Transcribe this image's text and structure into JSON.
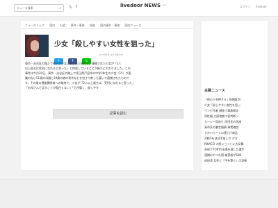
{
  "header": {
    "search_placeholder": "ニュース検索",
    "logo_text": "livedoor NEWS",
    "social_twitter": "𝕏",
    "social_facebook": "f",
    "links": [
      "ログイン",
      "livedoor"
    ]
  },
  "nav_tabs": [
    "ニューストップ",
    "国内",
    "社会",
    "事件・事故",
    "芸能",
    "国内事件・事故",
    "国内ニュース"
  ],
  "article": {
    "title": "少女「殺しやすい女性を狙った」",
    "date": "2022年6月24日 8時57分",
    "share": {
      "twitter": "t",
      "facebook": "f",
      "line": "L"
    },
    "body_lines": [
      "東京・渋谷区の路上で親子が少女に刺された事件で、逮捕された少女が「2人",
      "以上殺せば死刑になれると思った」と供述していることが新たにわかりました。この",
      "事件は今月20日、東京・渋谷区の路上で埼玉県戸田市の中学3年生の少女（15）が面",
      "識のない51歳の母親と19歳の娘の背中などを包丁で刺した疑いで逮捕されたもので",
      "す。その後の捜査関係者への取材で、少女が「2人以上殺せば、死刑になれると思った」",
      "「お母さんと話すことが面白くない」「力が弱く、殺しやす"
    ],
    "read_more": "記事を読む"
  },
  "sidebar": {
    "ranking_title": "主要ニュース",
    "items": [
      {
        "text": "「他の人を押さえ」投稿批判",
        "badge": ""
      },
      {
        "text": "少女「殺しやすい女性を狙っ",
        "badge": ""
      },
      {
        "text": "ワンピ作者 顔面で事故報告",
        "badge": ""
      },
      {
        "text": "同性婚 大阪地裁で初判断へ",
        "badge": ""
      },
      {
        "text": "カーシー見送り 岸田氏の思惑",
        "badge": ""
      },
      {
        "text": "高市氏の暴言指摘 事実確認",
        "badge": ""
      },
      {
        "text": "すかいらーくの値上げ商品",
        "badge": ""
      },
      {
        "text": "2億円をほぼ手放しか 夕方",
        "badge": ""
      },
      {
        "text": "RIKACO 大胆ショットに大反響",
        "badge": ""
      },
      {
        "text": "卓球でTOKYO出場を逃した選手",
        "badge": ""
      },
      {
        "text": "逮捕のやつれ顔 被害者がSNS",
        "badge": ""
      },
      {
        "text": "成田凌 女性と「手を繋ぐ」の証拠",
        "badge": ""
      }
    ]
  }
}
